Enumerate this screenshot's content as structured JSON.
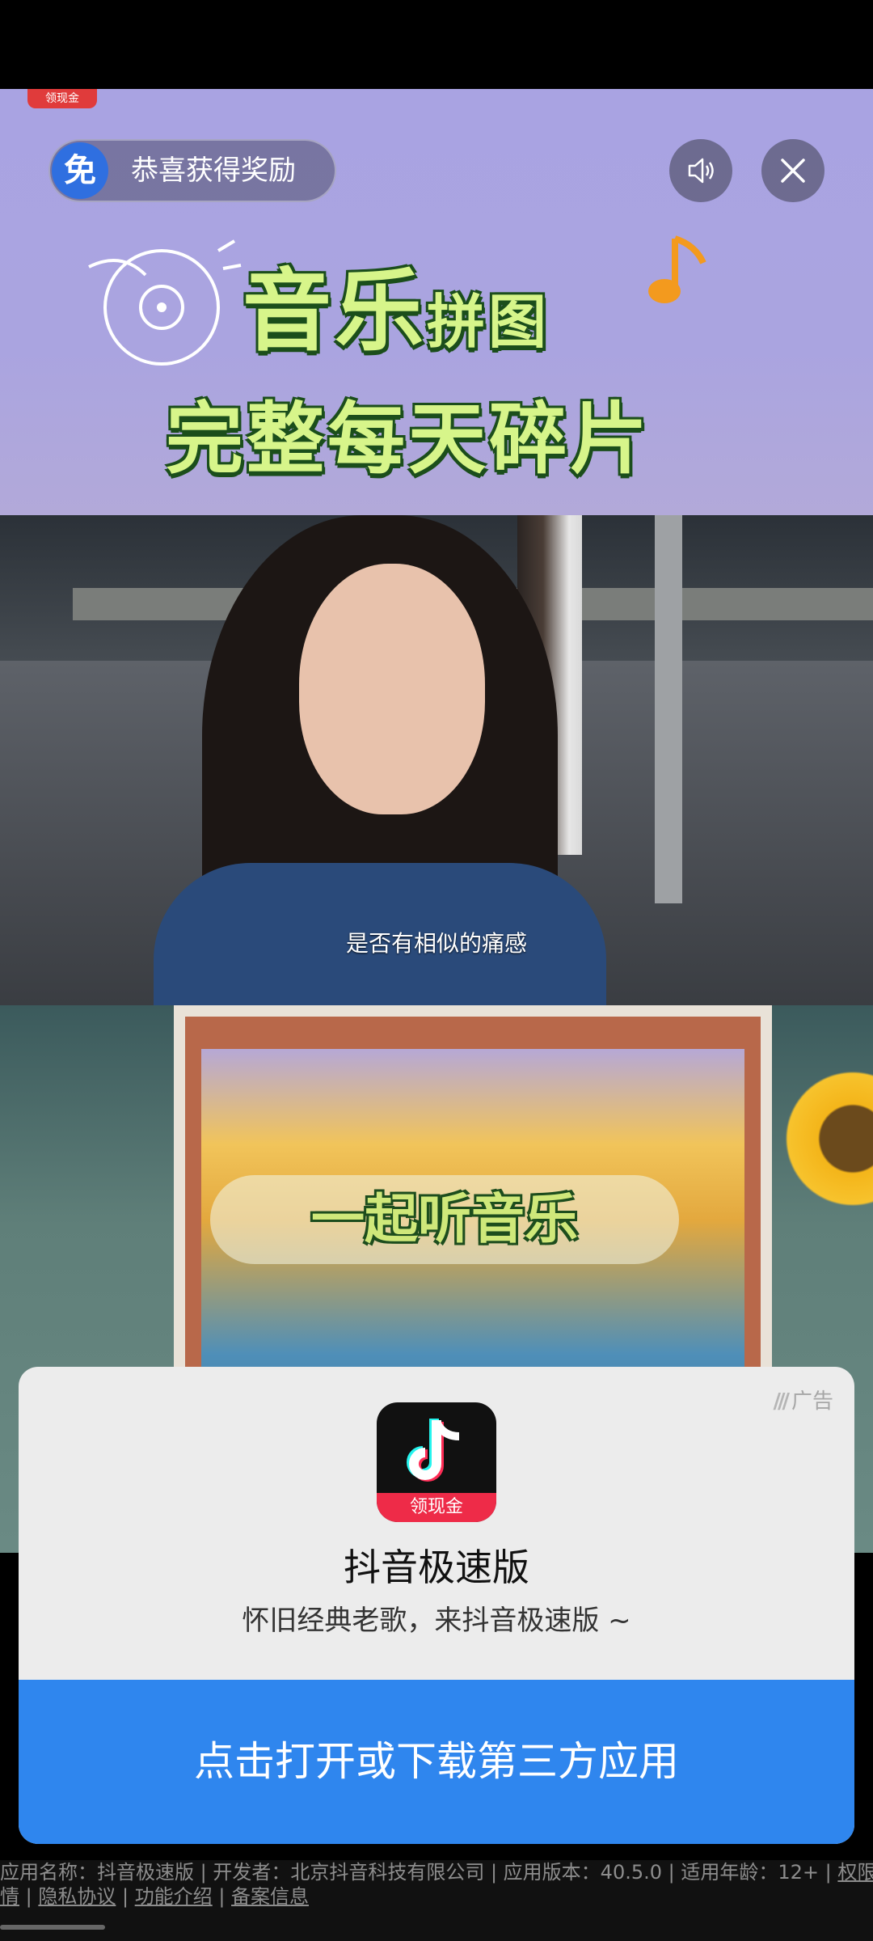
{
  "ad_overlay": {
    "brand_tag": "领现金",
    "reward": {
      "icon_text": "免",
      "label": "恭喜获得奖励"
    },
    "sound_button": "sound-icon",
    "close_button": "close-icon"
  },
  "banner": {
    "title_line1_big": "音乐",
    "title_line1_small": "拼图",
    "title_line2": "完整每天碎片"
  },
  "video": {
    "subtitle": "是否有相似的痛感",
    "chip_text": "一起听音乐"
  },
  "card": {
    "ad_label": "广告",
    "app_icon_tag": "领现金",
    "app_name": "抖音极速版",
    "app_desc": "怀旧经典老歌，来抖音极速版 ~",
    "open_button": "点击打开或下载第三方应用"
  },
  "footer": {
    "info_line": "应用名称：抖音极速版 | 开发者：北京抖音科技有限公司 | 应用版本：40.5.0 | 适用年龄：12+ |",
    "perm_part1": "权限详",
    "perm_part2": "情",
    "sep1": " | ",
    "privacy": "隐私协议",
    "sep2": " | ",
    "features": "功能介绍",
    "sep3": " | ",
    "filing": "备案信息"
  },
  "colors": {
    "accent_blue": "#2f86ee",
    "title_green": "#d7f58a",
    "banner_purple": "#a9a3e2"
  }
}
